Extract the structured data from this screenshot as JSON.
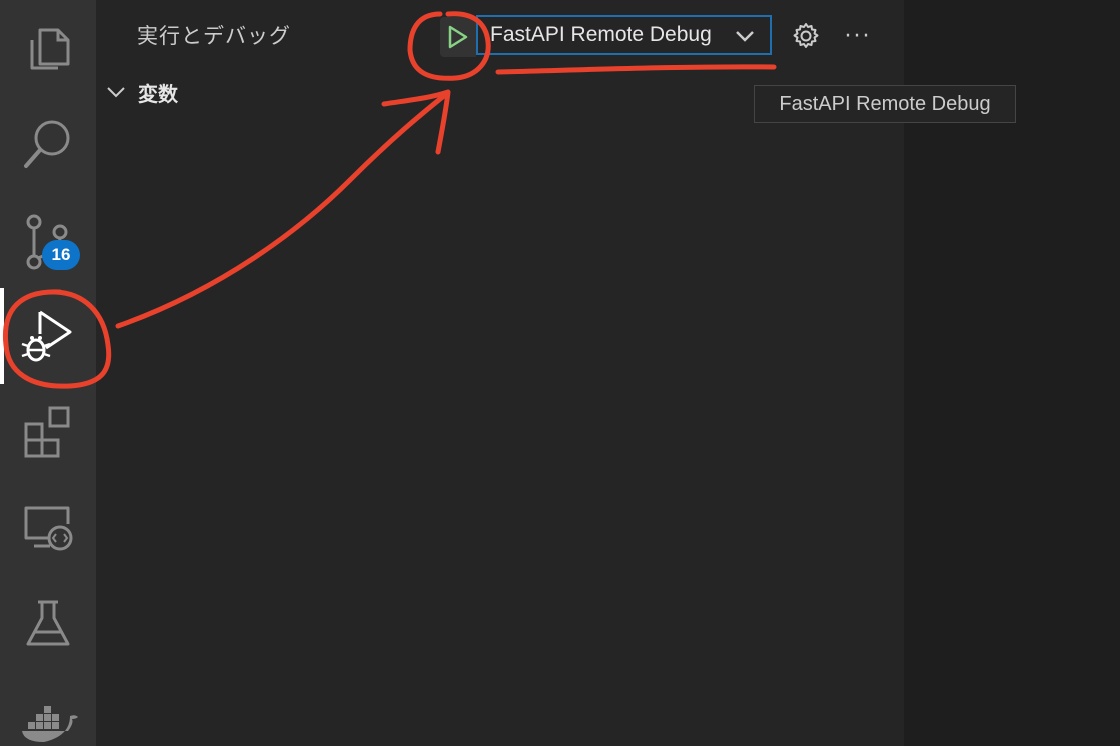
{
  "activity_bar": {
    "items": [
      {
        "name": "explorer-icon"
      },
      {
        "name": "search-icon"
      },
      {
        "name": "source-control-icon",
        "badge": "16"
      },
      {
        "name": "run-and-debug-icon",
        "active": true
      },
      {
        "name": "extensions-icon"
      },
      {
        "name": "remote-explorer-icon"
      },
      {
        "name": "testing-icon"
      },
      {
        "name": "docker-icon"
      }
    ]
  },
  "panel": {
    "title": "実行とデバッグ",
    "run_button_icon": "play-icon",
    "selected_config": "FastAPI Remote Debug",
    "gear_icon": "gear-icon",
    "more_label": "···",
    "section_title": "変数"
  },
  "tooltip": {
    "text": "FastAPI Remote Debug"
  },
  "colors": {
    "annotation": "#e8412c",
    "run_green": "#89d185",
    "focus_border": "#1f6fb0",
    "badge": "#0e74c9"
  }
}
